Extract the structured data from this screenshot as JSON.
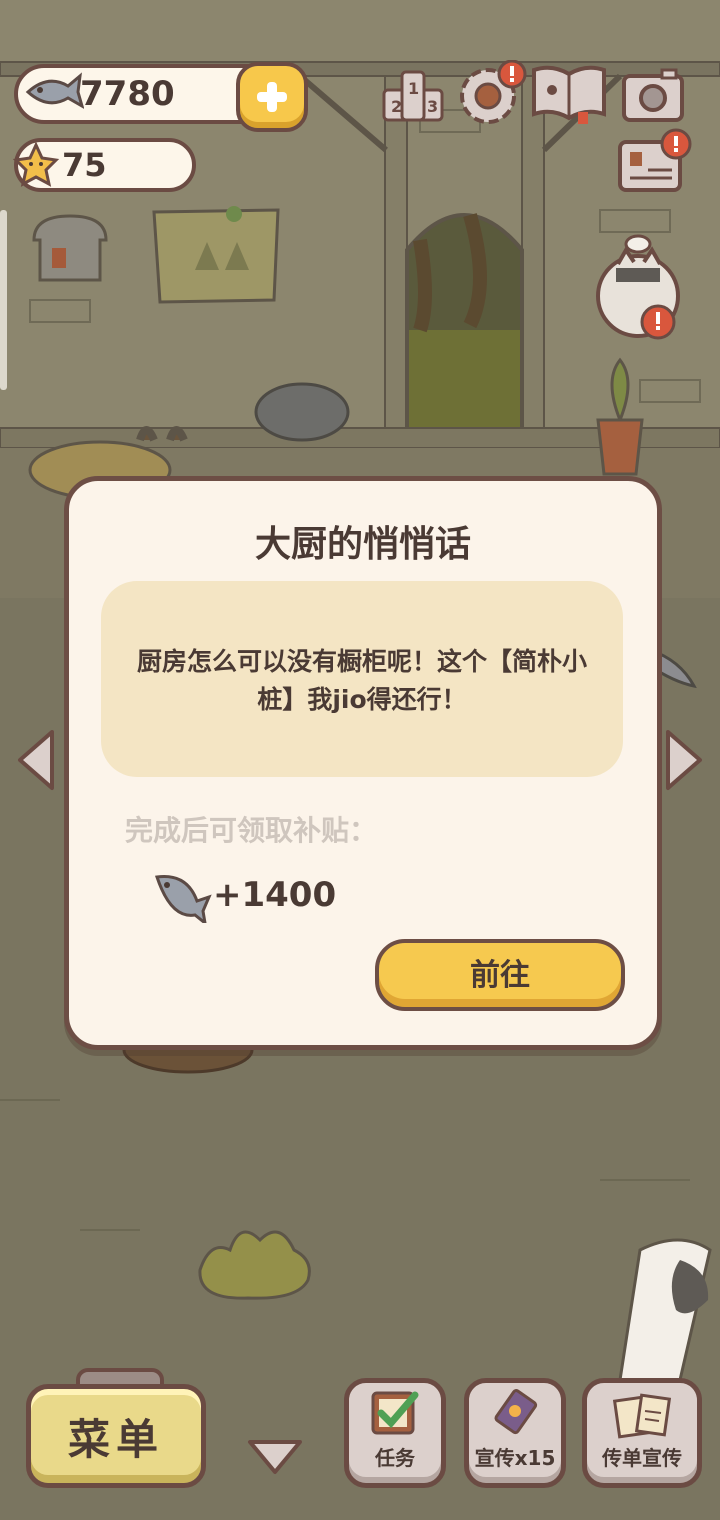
{
  "hud": {
    "fish_count": "7780",
    "star_count": "75",
    "icons": [
      "fish-icon",
      "plus-icon",
      "star-icon",
      "ranking-icon",
      "settings-icon",
      "cookbook-icon",
      "camera-icon",
      "notice-board-icon",
      "shop-icon",
      "chef-cat-icon"
    ]
  },
  "dialog": {
    "title": "大厨的悄悄话",
    "message": "厨房怎么可以没有橱柜呢！这个【简朴小桩】我jio得还行！",
    "reward_label": "完成后可领取补贴：",
    "reward_amount": "+1400",
    "go_button": "前往"
  },
  "bottom_bar": {
    "menu_label": "菜单",
    "task_label": "任务",
    "promo_label": "宣传x15",
    "flyer_label": "传单宣传"
  },
  "colors": {
    "accent_yellow": "#f6c94f",
    "border_brown": "#6d4e45",
    "dialog_bg": "#fcf4ea",
    "message_bg": "#f4e5c4",
    "alert_red": "#d9573d"
  }
}
